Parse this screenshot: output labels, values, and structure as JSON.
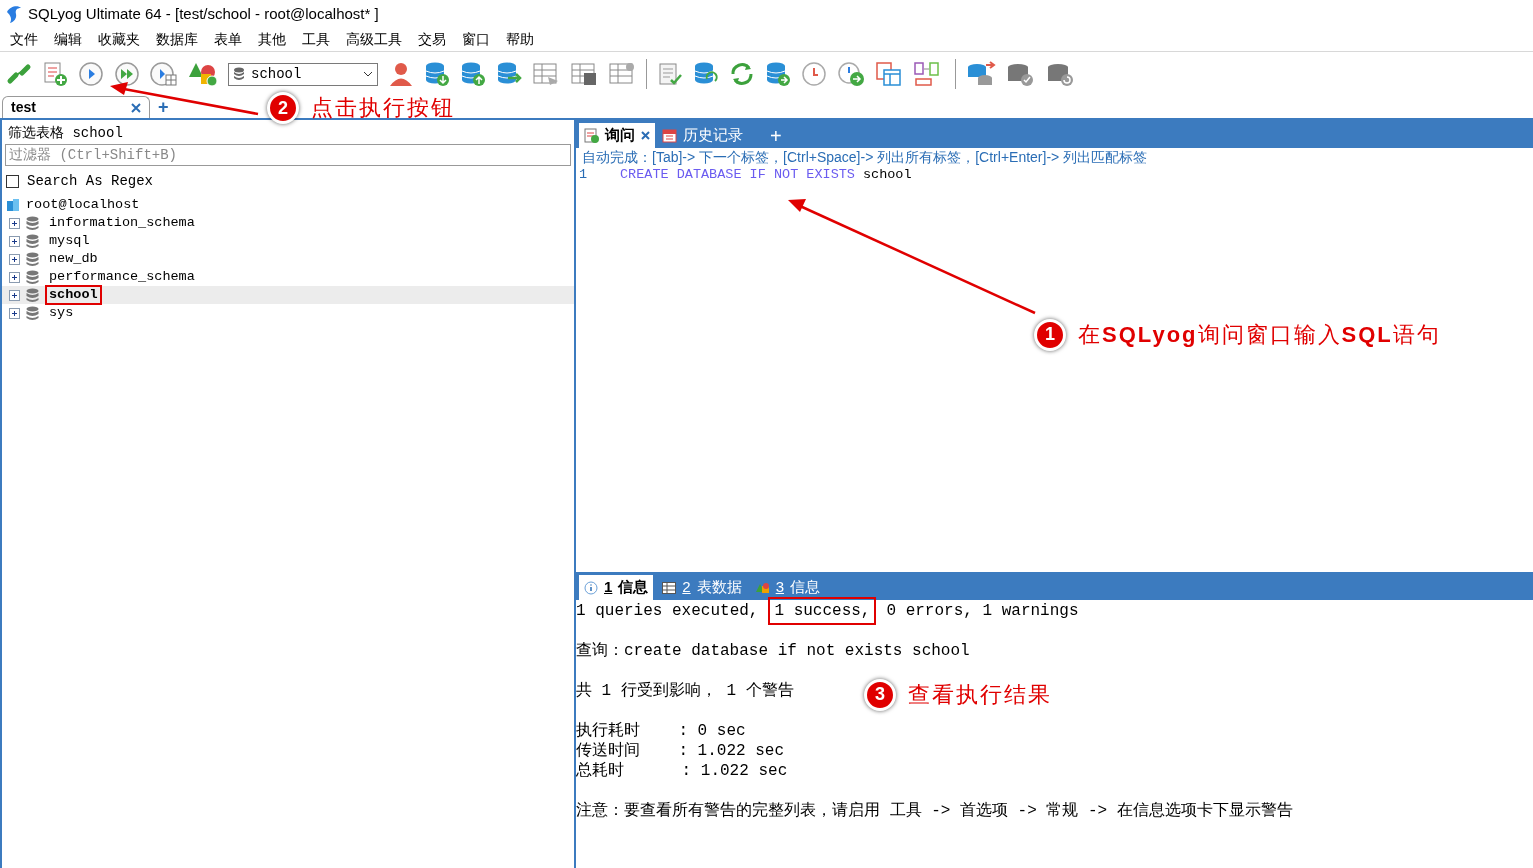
{
  "window": {
    "title": "SQLyog Ultimate 64 - [test/school - root@localhost* ]"
  },
  "menu": [
    "文件",
    "编辑",
    "收藏夹",
    "数据库",
    "表单",
    "其他",
    "工具",
    "高级工具",
    "交易",
    "窗口",
    "帮助"
  ],
  "toolbar": {
    "database_select": "school"
  },
  "connection_tabs": [
    {
      "label": "test",
      "selected": true
    }
  ],
  "new_tab_button": "+",
  "object_browser": {
    "filter_label": "筛选表格 school",
    "filter": {
      "placeholder": "过滤器 (Ctrl+Shift+B)"
    },
    "regex": {
      "label": "Search As Regex",
      "checked": false
    },
    "tree": {
      "label": "root@localhost",
      "children": [
        {
          "label": "information_schema",
          "selected": false,
          "highlighted": false
        },
        {
          "label": "mysql",
          "selected": false,
          "highlighted": false
        },
        {
          "label": "new_db",
          "selected": false,
          "highlighted": false
        },
        {
          "label": "performance_schema",
          "selected": false,
          "highlighted": false
        },
        {
          "label": "school",
          "selected": true,
          "highlighted": true
        },
        {
          "label": "sys",
          "selected": false,
          "highlighted": false
        }
      ]
    }
  },
  "query_tabs": [
    {
      "label": "询问",
      "selected": true,
      "kind": "query"
    },
    {
      "label": "历史记录",
      "selected": false,
      "kind": "history"
    }
  ],
  "query_new_tab": "+",
  "editor": {
    "hint": "自动完成：[Tab]-> 下一个标签，[Ctrl+Space]-> 列出所有标签，[Ctrl+Enter]-> 列出匹配标签",
    "lines": [
      {
        "number": "1",
        "tokens": [
          {
            "text": "CREATE DATABASE IF NOT EXISTS",
            "kind": "keyword"
          },
          {
            "text": "school",
            "kind": "identifier"
          }
        ]
      }
    ]
  },
  "result_tabs": [
    {
      "number": "1",
      "label": "信息",
      "selected": true,
      "kind": "info"
    },
    {
      "number": "2",
      "label": "表数据",
      "selected": false,
      "kind": "table"
    },
    {
      "number": "3",
      "label": "信息",
      "selected": false,
      "kind": "warning"
    }
  ],
  "message_blocks": [
    [
      {
        "parts": [
          {
            "text": "1 queries executed,",
            "boxed": false
          },
          {
            "text": "1 success,",
            "boxed": true
          },
          {
            "text": "0 errors, 1 warnings",
            "boxed": false
          }
        ]
      }
    ],
    [
      {
        "parts": [
          {
            "text": "查询：create database if not exists school",
            "boxed": false
          }
        ]
      }
    ],
    [
      {
        "parts": [
          {
            "text": "共 1 行受到影响， 1 个警告",
            "boxed": false
          }
        ]
      }
    ],
    [
      {
        "parts": [
          {
            "text": "执行耗时    : 0 sec",
            "boxed": false
          }
        ]
      },
      {
        "parts": [
          {
            "text": "传送时间    : 1.022 sec",
            "boxed": false
          }
        ]
      },
      {
        "parts": [
          {
            "text": "总耗时      : 1.022 sec",
            "boxed": false
          }
        ]
      }
    ],
    [
      {
        "parts": [
          {
            "text": "注意：要查看所有警告的完整列表，请启用 工具 -> 首选项 -> 常规 -> 在信息选项卡下显示警告",
            "boxed": false
          }
        ]
      }
    ]
  ],
  "annotations": [
    {
      "number": "1",
      "text": "在**SQLyog**询问窗口输入**SQL**语句"
    },
    {
      "number": "2",
      "text": "点击执行按钮"
    },
    {
      "number": "3",
      "text": "查看执行结果"
    }
  ]
}
